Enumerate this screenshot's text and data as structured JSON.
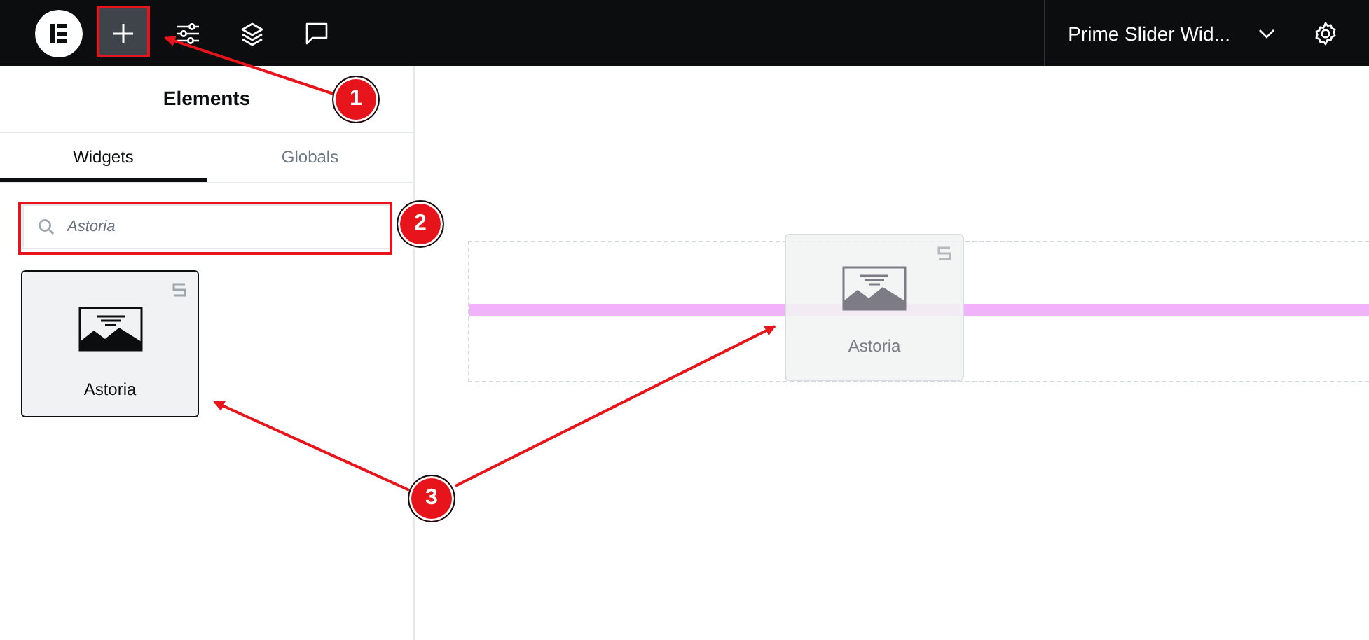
{
  "topbar": {
    "document_title": "Prime Slider Wid..."
  },
  "panel": {
    "title": "Elements",
    "tabs": [
      {
        "label": "Widgets",
        "selected": true
      },
      {
        "label": "Globals",
        "selected": false
      }
    ],
    "search": {
      "value": "Astoria"
    },
    "widgets": [
      {
        "label": "Astoria"
      }
    ]
  },
  "canvas": {
    "dragged_widget": {
      "label": "Astoria"
    }
  },
  "annotations": [
    {
      "number": "1"
    },
    {
      "number": "2"
    },
    {
      "number": "3"
    }
  ]
}
